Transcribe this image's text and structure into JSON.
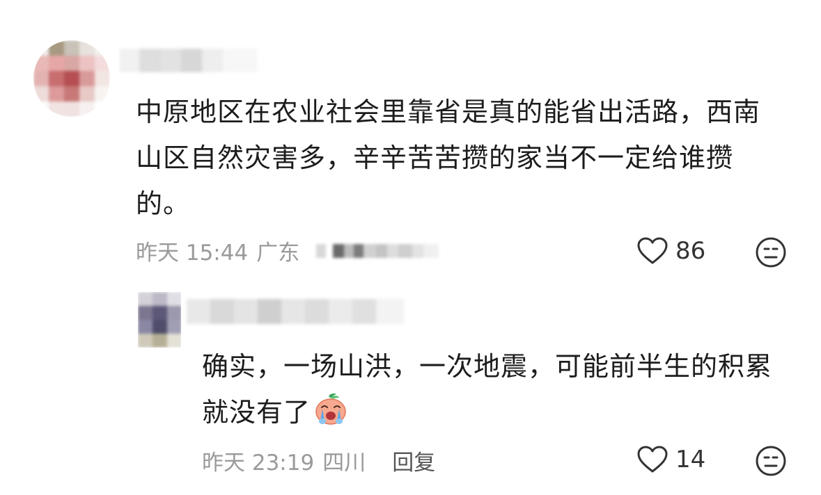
{
  "comment": {
    "text": "中原地区在农业社会里靠省是真的能省出活路，西南山区自然灾害多，辛辛苦苦攒的家当不一定给谁攒的。",
    "time": "昨天 15:44",
    "location": "广东",
    "likes": "86",
    "icons": {
      "like": "heart-outline-icon",
      "dislike": "unhappy-face-icon"
    }
  },
  "reply": {
    "text": "确实，一场山洪，一次地震，可能前半生的积累就没有了",
    "emoji": "crying-peach-emoji",
    "time": "昨天 23:19",
    "location": "四川",
    "reply_label": "回复",
    "likes": "14",
    "icons": {
      "like": "heart-outline-icon",
      "dislike": "unhappy-face-icon"
    }
  },
  "colors": {
    "text": "#1c1c1c",
    "meta": "#9a9a9a",
    "icon": "#333333"
  }
}
